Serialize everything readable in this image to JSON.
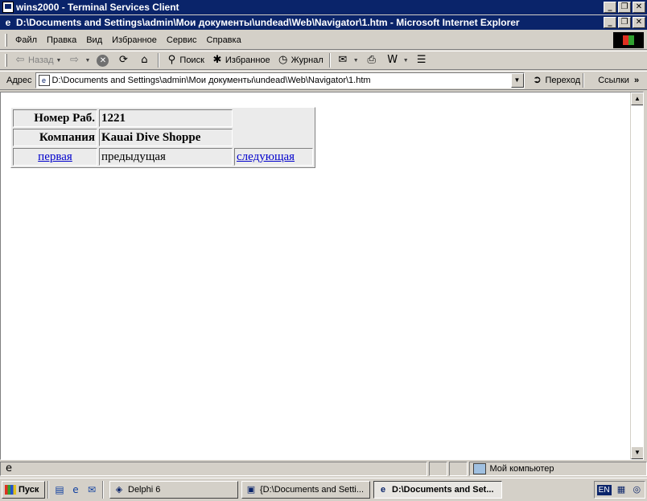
{
  "outer_window": {
    "title": "wins2000 - Terminal Services Client",
    "buttons": {
      "minimize": "_",
      "restore": "❐",
      "close": "✕"
    }
  },
  "ie_window": {
    "title": "D:\\Documents and Settings\\admin\\Мои документы\\undead\\Web\\Navigator\\1.htm - Microsoft Internet Explorer",
    "buttons": {
      "minimize": "_",
      "restore": "❐",
      "close": "✕"
    }
  },
  "menu": {
    "items": [
      {
        "label": "Файл"
      },
      {
        "label": "Правка"
      },
      {
        "label": "Вид"
      },
      {
        "label": "Избранное"
      },
      {
        "label": "Сервис"
      },
      {
        "label": "Справка"
      }
    ]
  },
  "toolbar": {
    "back_label": "Назад",
    "search_label": "Поиск",
    "favorites_label": "Избранное",
    "history_label": "Журнал",
    "icons": {
      "back": "back-arrow-icon",
      "forward": "forward-arrow-icon",
      "stop": "stop-icon",
      "refresh": "refresh-icon",
      "home": "home-icon",
      "search": "search-icon",
      "favorites": "favorites-icon",
      "history": "history-icon",
      "mail": "mail-icon",
      "print": "print-icon",
      "edit": "word-edit-icon",
      "discuss": "discuss-icon"
    }
  },
  "address": {
    "label": "Адрес",
    "value": "D:\\Documents and Settings\\admin\\Мои документы\\undead\\Web\\Navigator\\1.htm",
    "go_label": "Переход",
    "links_label": "Ссылки"
  },
  "record": {
    "rows": [
      {
        "label": "Номер Раб.",
        "value": "1221"
      },
      {
        "label": "Компания",
        "value": "Kauai Dive Shoppe"
      }
    ],
    "nav": {
      "first": "первая",
      "prev": "предыдущая",
      "next": "следующая"
    }
  },
  "status": {
    "text": "",
    "zone": "Мой компьютер"
  },
  "taskbar": {
    "start_label": "Пуск",
    "tasks": [
      {
        "label": "Delphi 6",
        "active": false
      },
      {
        "label": "{D:\\Documents and Setti...",
        "active": false
      },
      {
        "label": "D:\\Documents and Set...",
        "active": true
      }
    ],
    "tray": {
      "lang": "EN"
    }
  }
}
